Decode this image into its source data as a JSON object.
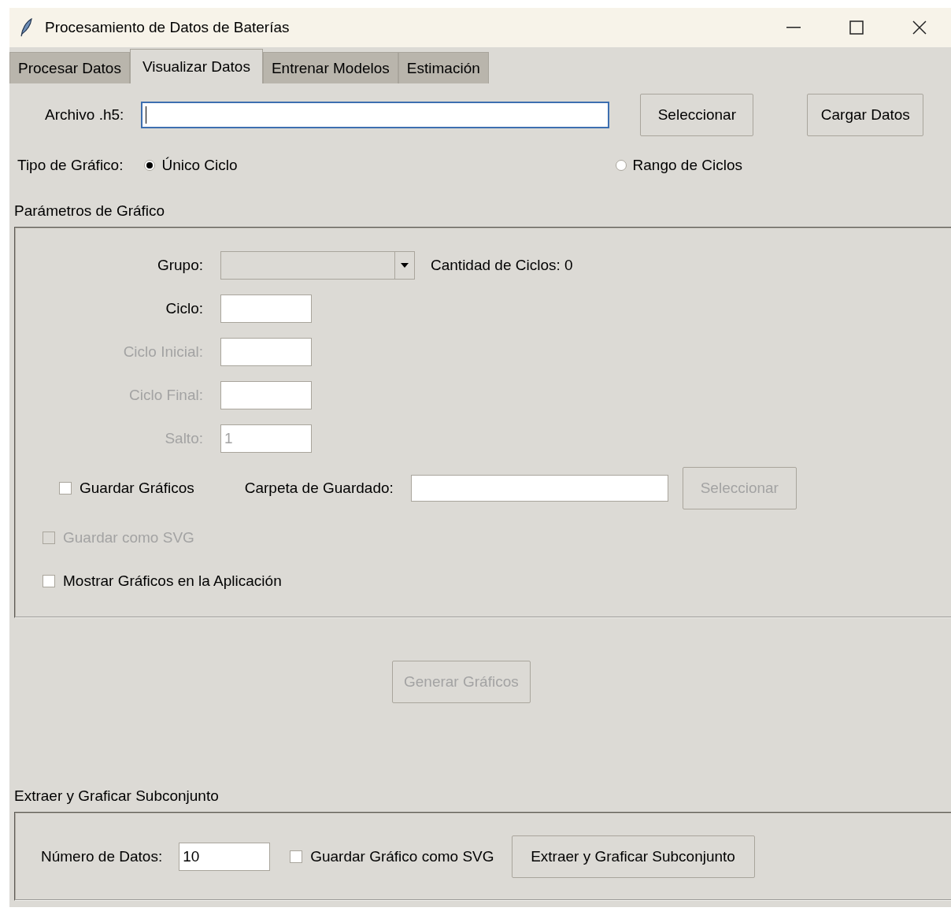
{
  "window": {
    "title": "Procesamiento de Datos de Baterías"
  },
  "tabs": [
    {
      "label": "Procesar Datos",
      "selected": false
    },
    {
      "label": "Visualizar Datos",
      "selected": true
    },
    {
      "label": "Entrenar Modelos",
      "selected": false
    },
    {
      "label": "Estimación",
      "selected": false
    }
  ],
  "file_row": {
    "label": "Archivo .h5:",
    "buttons": [
      {
        "label": "Seleccionar"
      },
      {
        "label": "Cargar Datos"
      }
    ]
  },
  "chart_type": {
    "label": "Tipo de Gráfico:",
    "options": [
      {
        "label": "Único Ciclo",
        "selected": true
      },
      {
        "label": "Rango de Ciclos",
        "selected": false
      }
    ]
  },
  "params": {
    "title": "Parámetros de Gráfico",
    "group": {
      "label": "Grupo:",
      "count_text": "Cantidad de Ciclos: 0"
    },
    "fields": [
      {
        "label": "Ciclo:",
        "disabled": false
      },
      {
        "label": "Ciclo Inicial:",
        "disabled": true
      },
      {
        "label": "Ciclo Final:",
        "disabled": true
      },
      {
        "label": "Salto:",
        "value": "1",
        "disabled": true
      }
    ],
    "save_charts": {
      "label": "Guardar Gráficos",
      "checked": false
    },
    "folder": {
      "label": "Carpeta de Guardado:"
    },
    "folder_button": {
      "label": "Seleccionar",
      "disabled": true
    },
    "save_svg": {
      "label": "Guardar como SVG",
      "checked": false,
      "disabled": true
    },
    "show_in_app": {
      "label": "Mostrar Gráficos en la Aplicación",
      "checked": false
    }
  },
  "generate_button": {
    "label": "Generar Gráficos",
    "disabled": true
  },
  "subset": {
    "title": "Extraer y Graficar Subconjunto",
    "count": {
      "label": "Número de Datos:",
      "value": "10"
    },
    "save_svg": {
      "label": "Guardar Gráfico como SVG",
      "checked": false
    },
    "button": {
      "label": "Extraer y Graficar Subconjunto"
    }
  }
}
